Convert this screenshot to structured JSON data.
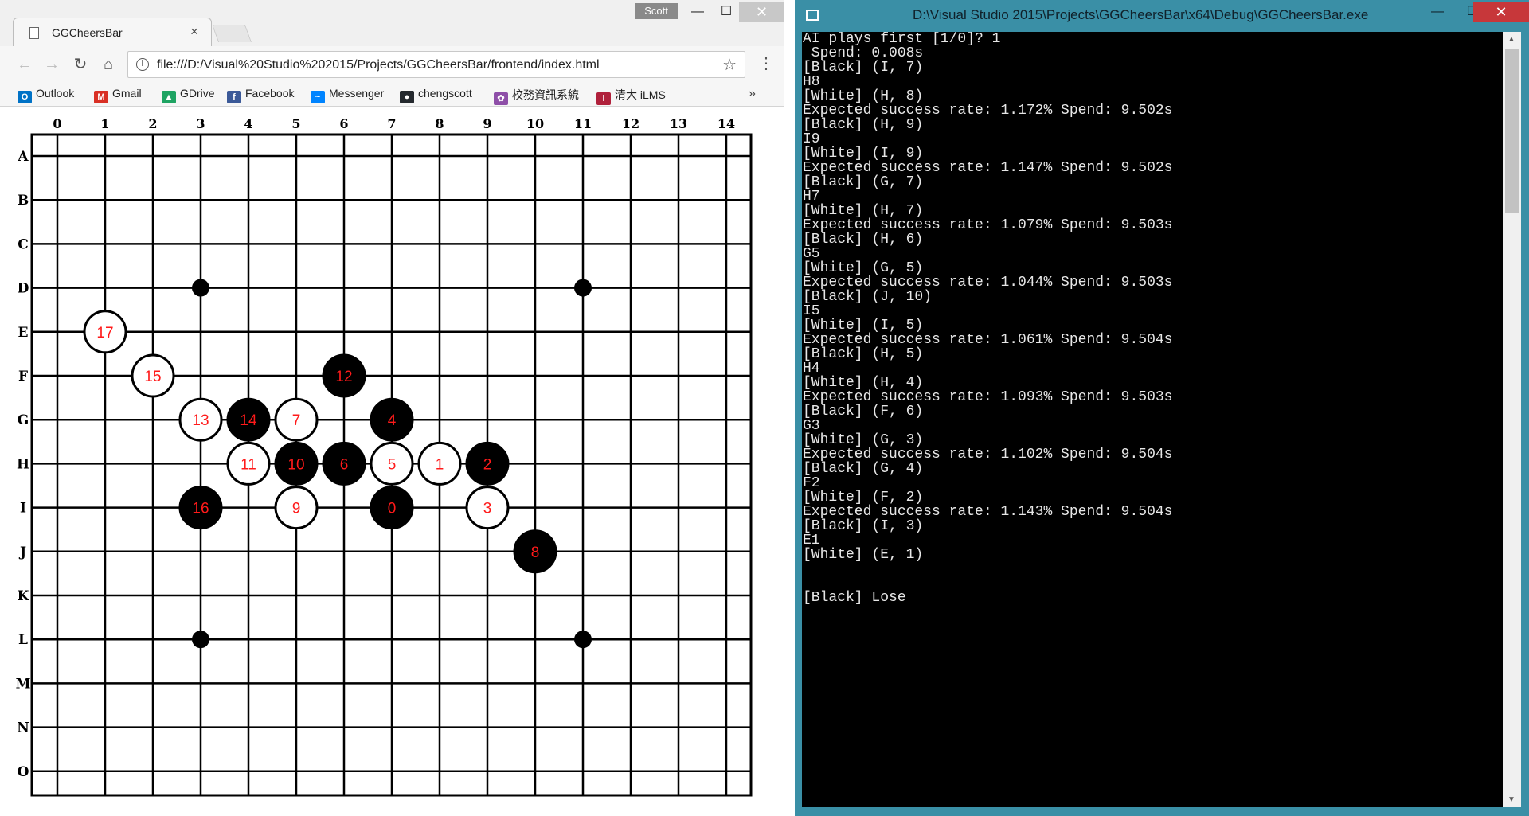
{
  "browser": {
    "tab_title": "GGCheersBar",
    "tab_close": "×",
    "profile": "Scott",
    "url": "file:///D:/Visual%20Studio%202015/Projects/GGCheersBar/frontend/index.html",
    "bookmarks": [
      {
        "label": "Outlook",
        "icon": "outlook-icon",
        "color": "#0072c6",
        "glyph": "O"
      },
      {
        "label": "Gmail",
        "icon": "gmail-icon",
        "color": "#d93025",
        "glyph": "M"
      },
      {
        "label": "GDrive",
        "icon": "gdrive-icon",
        "color": "#1fa463",
        "glyph": "▲"
      },
      {
        "label": "Facebook",
        "icon": "facebook-icon",
        "color": "#3b5998",
        "glyph": "f"
      },
      {
        "label": "Messenger",
        "icon": "messenger-icon",
        "color": "#0084ff",
        "glyph": "~"
      },
      {
        "label": "chengscott",
        "icon": "github-icon",
        "color": "#24292e",
        "glyph": "●"
      },
      {
        "label": "校務資訊系統",
        "icon": "school-portal-icon",
        "color": "#8e4fa8",
        "glyph": "✿"
      },
      {
        "label": "清大 iLMS",
        "icon": "ilms-icon",
        "color": "#b0203b",
        "glyph": "i"
      }
    ]
  },
  "board": {
    "size": 15,
    "col_labels": [
      "0",
      "1",
      "2",
      "3",
      "4",
      "5",
      "6",
      "7",
      "8",
      "9",
      "10",
      "11",
      "12",
      "13",
      "14"
    ],
    "row_labels": [
      "A",
      "B",
      "C",
      "D",
      "E",
      "F",
      "G",
      "H",
      "I",
      "J",
      "K",
      "L",
      "M",
      "N",
      "O"
    ],
    "star_points": [
      [
        "D",
        3
      ],
      [
        "D",
        11
      ],
      [
        "L",
        3
      ],
      [
        "L",
        11
      ]
    ],
    "stone_colors": {
      "black": "#000000",
      "white": "#ffffff",
      "label": "#ff1a1a"
    },
    "stones": [
      {
        "n": 0,
        "row": "I",
        "col": 7,
        "color": "black"
      },
      {
        "n": 1,
        "row": "H",
        "col": 8,
        "color": "white"
      },
      {
        "n": 2,
        "row": "H",
        "col": 9,
        "color": "black"
      },
      {
        "n": 3,
        "row": "I",
        "col": 9,
        "color": "white"
      },
      {
        "n": 4,
        "row": "G",
        "col": 7,
        "color": "black"
      },
      {
        "n": 5,
        "row": "H",
        "col": 7,
        "color": "white"
      },
      {
        "n": 6,
        "row": "H",
        "col": 6,
        "color": "black"
      },
      {
        "n": 7,
        "row": "G",
        "col": 5,
        "color": "white"
      },
      {
        "n": 8,
        "row": "J",
        "col": 10,
        "color": "black"
      },
      {
        "n": 9,
        "row": "I",
        "col": 5,
        "color": "white"
      },
      {
        "n": 10,
        "row": "H",
        "col": 5,
        "color": "black"
      },
      {
        "n": 11,
        "row": "H",
        "col": 4,
        "color": "white"
      },
      {
        "n": 12,
        "row": "F",
        "col": 6,
        "color": "black"
      },
      {
        "n": 13,
        "row": "G",
        "col": 3,
        "color": "white"
      },
      {
        "n": 14,
        "row": "G",
        "col": 4,
        "color": "black"
      },
      {
        "n": 15,
        "row": "F",
        "col": 2,
        "color": "white"
      },
      {
        "n": 16,
        "row": "I",
        "col": 3,
        "color": "black"
      },
      {
        "n": 17,
        "row": "E",
        "col": 1,
        "color": "white"
      }
    ]
  },
  "console": {
    "title": "D:\\Visual Studio 2015\\Projects\\GGCheersBar\\x64\\Debug\\GGCheersBar.exe",
    "lines": [
      "AI plays first [1/0]? 1",
      " Spend: 0.008s",
      "[Black] (I, 7)",
      "H8",
      "[White] (H, 8)",
      "Expected success rate: 1.172% Spend: 9.502s",
      "[Black] (H, 9)",
      "I9",
      "[White] (I, 9)",
      "Expected success rate: 1.147% Spend: 9.502s",
      "[Black] (G, 7)",
      "H7",
      "[White] (H, 7)",
      "Expected success rate: 1.079% Spend: 9.503s",
      "[Black] (H, 6)",
      "G5",
      "[White] (G, 5)",
      "Expected success rate: 1.044% Spend: 9.503s",
      "[Black] (J, 10)",
      "I5",
      "[White] (I, 5)",
      "Expected success rate: 1.061% Spend: 9.504s",
      "[Black] (H, 5)",
      "H4",
      "[White] (H, 4)",
      "Expected success rate: 1.093% Spend: 9.503s",
      "[Black] (F, 6)",
      "G3",
      "[White] (G, 3)",
      "Expected success rate: 1.102% Spend: 9.504s",
      "[Black] (G, 4)",
      "F2",
      "[White] (F, 2)",
      "Expected success rate: 1.143% Spend: 9.504s",
      "[Black] (I, 3)",
      "E1",
      "[White] (E, 1)",
      "",
      "",
      "[Black] Lose"
    ]
  }
}
